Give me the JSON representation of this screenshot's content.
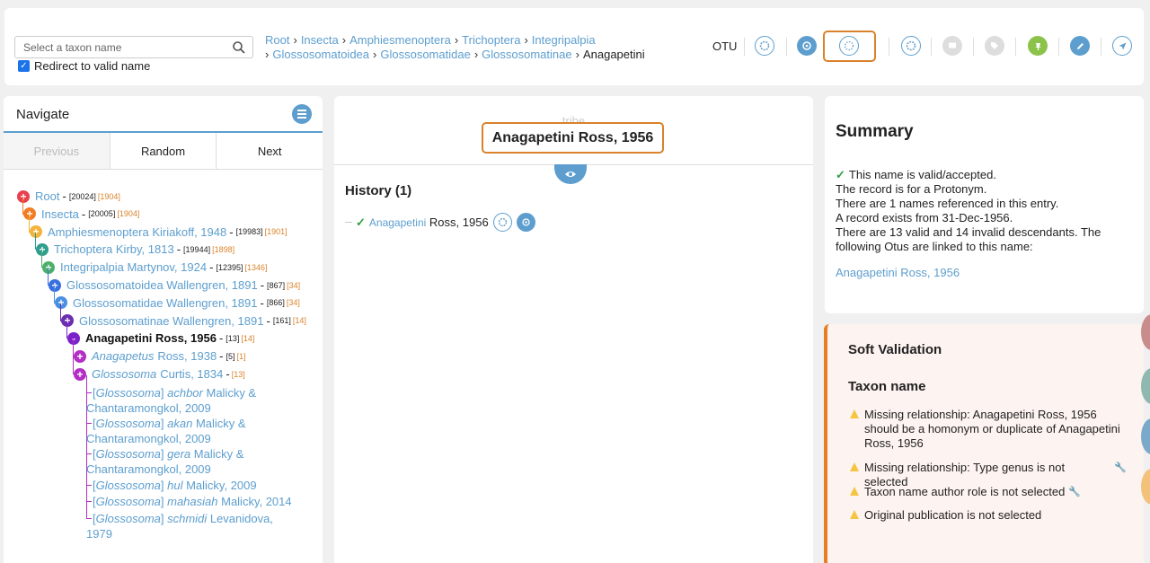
{
  "header": {
    "search_placeholder": "Select a taxon name",
    "redirect_label": "Redirect to valid name",
    "redirect_checked": true,
    "breadcrumb_line1": [
      "Root",
      "Insecta",
      "Amphiesmenoptera",
      "Trichoptera",
      "Integripalpia"
    ],
    "breadcrumb_line2": [
      "Glossosomatoidea",
      "Glossosomatidae",
      "Glossosomatinae"
    ],
    "breadcrumb_current": "Anagapetini",
    "otu_label": "OTU",
    "icons": [
      "otu-radial-icon",
      "otu-browse-icon",
      "radial-annotator-icon",
      "radial-navigator-icon",
      "comment-icon",
      "tag-icon",
      "pin-icon",
      "edit-icon",
      "navigate-icon"
    ]
  },
  "navigate": {
    "title": "Navigate",
    "tabs": {
      "previous": "Previous",
      "random": "Random",
      "next": "Next"
    },
    "tree": [
      {
        "name": "Root",
        "author": "",
        "valid": "20024",
        "invalid": "1904",
        "color": "#e8404f",
        "sign": "+"
      },
      {
        "name": "Insecta",
        "author": "",
        "valid": "20005",
        "invalid": "1904",
        "color": "#f07c24",
        "sign": "+"
      },
      {
        "name": "Amphiesmenoptera Kiriakoff, 1948",
        "author": "",
        "valid": "19983",
        "invalid": "1901",
        "color": "#f5b33c",
        "sign": "+"
      },
      {
        "name": "Trichoptera Kirby, 1813",
        "author": "",
        "valid": "19944",
        "invalid": "1898",
        "color": "#2e9e8e",
        "sign": "+"
      },
      {
        "name": "Integripalpia Martynov, 1924",
        "author": "",
        "valid": "12395",
        "invalid": "1346",
        "color": "#4caf6a",
        "sign": "+"
      },
      {
        "name": "Glossosomatoidea Wallengren, 1891",
        "author": "",
        "valid": "867",
        "invalid": "34",
        "color": "#3a6fe0",
        "sign": "+"
      },
      {
        "name": "Glossosomatidae Wallengren, 1891",
        "author": "",
        "valid": "866",
        "invalid": "34",
        "color": "#4a90e2",
        "sign": "+"
      },
      {
        "name": "Glossosomatinae Wallengren, 1891",
        "author": "",
        "valid": "161",
        "invalid": "14",
        "color": "#6a2fb0",
        "sign": "+"
      },
      {
        "name": "Anagapetini Ross, 1956",
        "author": "",
        "valid": "13",
        "invalid": "14",
        "color": "#7b22c9",
        "sign": "-"
      },
      {
        "name": "Anagapetus",
        "author": "Ross, 1938",
        "valid": "5",
        "invalid": "1",
        "color": "#b22ec4",
        "sign": "+"
      },
      {
        "name": "Glossosoma",
        "author": "Curtis, 1834",
        "valid": "",
        "invalid": "13",
        "color": "#b22ec4",
        "sign": "+"
      }
    ],
    "leaves": [
      {
        "genus": "Glossosoma",
        "species": "achbor",
        "author_line1": "Malicky &",
        "author_line2": "Chantaramongkol, 2009"
      },
      {
        "genus": "Glossosoma",
        "species": "akan",
        "author_line1": "Malicky &",
        "author_line2": "Chantaramongkol, 2009"
      },
      {
        "genus": "Glossosoma",
        "species": "gera",
        "author_line1": "Malicky &",
        "author_line2": "Chantaramongkol, 2009"
      },
      {
        "genus": "Glossosoma",
        "species": "hul",
        "author_line1": "Malicky, 2009",
        "author_line2": ""
      },
      {
        "genus": "Glossosoma",
        "species": "mahasiah",
        "author_line1": "Malicky, 2014",
        "author_line2": ""
      },
      {
        "genus": "Glossosoma",
        "species": "schmidi",
        "author_line1": "Levanidova, 1979",
        "author_line2": ""
      }
    ]
  },
  "main": {
    "rank": "tribe",
    "title": "Anagapetini Ross, 1956",
    "history_title": "History (1)",
    "history_name": "Anagapetini",
    "history_author": "Ross, 1956"
  },
  "summary": {
    "title": "Summary",
    "line1": "This name is valid/accepted.",
    "line2": "The record is for a Protonym.",
    "line3": "There are 1 names referenced in this entry.",
    "line4": "A record exists from 31-Dec-1956.",
    "line5": "There are 13 valid and 14 invalid descendants. The following Otus are linked to this name:",
    "otu_link": "Anagapetini Ross, 1956"
  },
  "soft_validation": {
    "title": "Soft Validation",
    "section": "Taxon name",
    "warnings": [
      "Missing relationship: Anagapetini Ross, 1956 should be a homonym or duplicate of Anagapetini Ross, 1956",
      "Missing relationship: Type genus is not selected",
      "Taxon name author role is not selected",
      "Original publication is not selected"
    ]
  },
  "colors": {
    "accent": "#5d9ece",
    "highlight": "#d9822b",
    "valid": "#2e9e3e",
    "warning": "#f5c542"
  }
}
